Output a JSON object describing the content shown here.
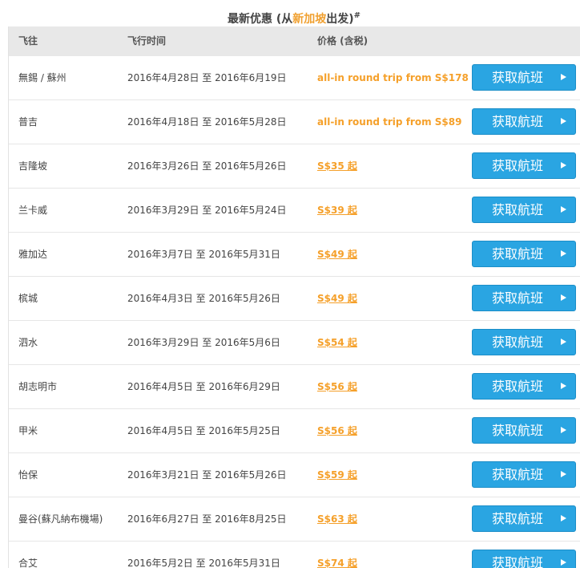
{
  "title": {
    "prefix": "最新优惠 (从",
    "city": "新加坡",
    "suffix": "出发)",
    "mark": "#"
  },
  "columns": {
    "destination": "飞往",
    "dates": "飞行时间",
    "price": "价格 (含税)"
  },
  "button_label": "获取航班",
  "colors": {
    "accent_orange": "#f5a02a",
    "button_blue": "#2aa5e2"
  },
  "rows": [
    {
      "destination": "無錫 / 蘇州",
      "dates": "2016年4月28日 至 2016年6月19日",
      "price": "all-in round trip from S$178"
    },
    {
      "destination": "普吉",
      "dates": "2016年4月18日 至 2016年5月28日",
      "price": "all-in round trip from S$89"
    },
    {
      "destination": "吉隆坡",
      "dates": "2016年3月26日 至 2016年5月26日",
      "price": "S$35 起"
    },
    {
      "destination": "兰卡威",
      "dates": "2016年3月29日 至 2016年5月24日",
      "price": "S$39 起"
    },
    {
      "destination": "雅加达",
      "dates": "2016年3月7日 至 2016年5月31日",
      "price": "S$49 起"
    },
    {
      "destination": "槟城",
      "dates": "2016年4月3日 至 2016年5月26日",
      "price": "S$49 起"
    },
    {
      "destination": "泗水",
      "dates": "2016年3月29日 至 2016年5月6日",
      "price": "S$54 起"
    },
    {
      "destination": "胡志明市",
      "dates": "2016年4月5日 至 2016年6月29日",
      "price": "S$56 起"
    },
    {
      "destination": "甲米",
      "dates": "2016年4月5日 至 2016年5月25日",
      "price": "S$56 起"
    },
    {
      "destination": "怡保",
      "dates": "2016年3月21日 至 2016年5月26日",
      "price": "S$59 起"
    },
    {
      "destination": "曼谷(蘇凡納布機場)",
      "dates": "2016年6月27日 至 2016年8月25日",
      "price": "S$63 起"
    },
    {
      "destination": "合艾",
      "dates": "2016年5月2日 至 2016年5月31日",
      "price": "S$74 起"
    }
  ]
}
